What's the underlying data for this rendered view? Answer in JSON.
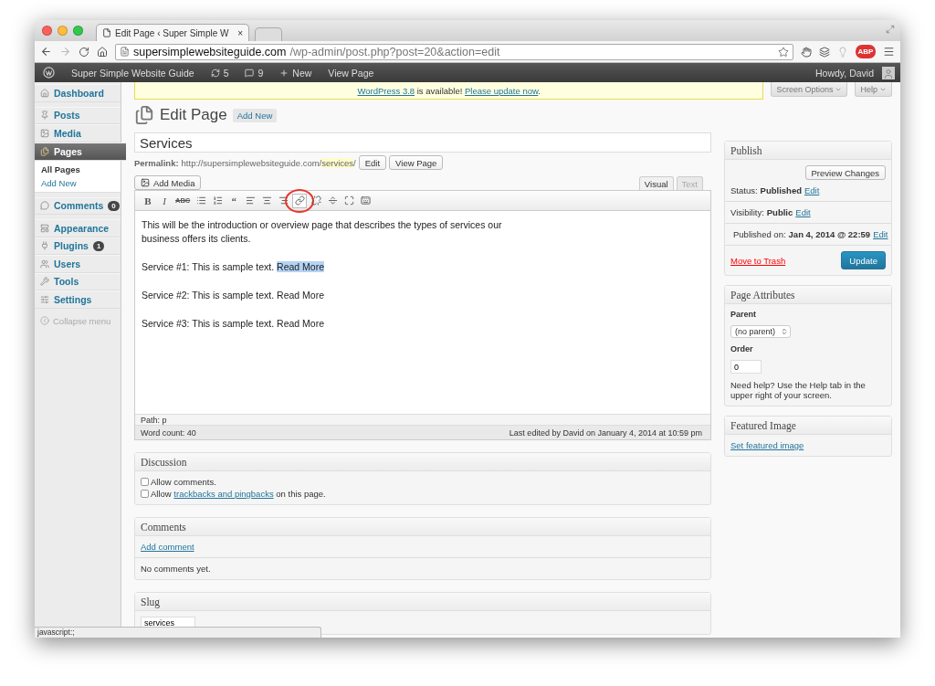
{
  "browser": {
    "tab_title": "Edit Page ‹ Super Simple W",
    "tab_close": "×",
    "url_host": "supersimplewebsiteguide.com",
    "url_path": "/wp-admin/post.php?post=20&action=edit",
    "extension_badge": "ABP"
  },
  "admin_bar": {
    "site": "Super Simple Website Guide",
    "updates": "5",
    "comments": "9",
    "new": "New",
    "view": "View Page",
    "greeting": "Howdy, David"
  },
  "sidebar": {
    "items": [
      {
        "label": "Dashboard",
        "selected": false
      },
      {
        "label": "Posts",
        "selected": false
      },
      {
        "label": "Media",
        "selected": false
      },
      {
        "label": "Pages",
        "selected": true,
        "children": [
          {
            "label": "All Pages",
            "selected": true
          },
          {
            "label": "Add New",
            "selected": false
          }
        ]
      },
      {
        "label": "Comments",
        "selected": false,
        "badge": "0"
      },
      {
        "label": "Appearance",
        "selected": false
      },
      {
        "label": "Plugins",
        "selected": false,
        "badge": "1"
      },
      {
        "label": "Users",
        "selected": false
      },
      {
        "label": "Tools",
        "selected": false
      },
      {
        "label": "Settings",
        "selected": false
      }
    ],
    "collapse": "Collapse menu"
  },
  "notice": {
    "parts": [
      {
        "text": "WordPress 3.8",
        "link": true
      },
      {
        "text": " is available! ",
        "link": false
      },
      {
        "text": "Please update now",
        "link": true
      },
      {
        "text": ".",
        "link": false
      }
    ]
  },
  "screen_tabs": [
    "Screen Options",
    "Help"
  ],
  "heading": {
    "title": "Edit Page",
    "add_new": "Add New"
  },
  "editor": {
    "title": "Services",
    "permalink_label": "Permalink:",
    "permalink_base": "http://supersimplewebsiteguide.com/",
    "permalink_slug": "services",
    "permalink_end": "/",
    "edit": "Edit",
    "view": "View Page",
    "add_media": "Add Media",
    "tabs": [
      {
        "label": "Visual",
        "selected": true
      },
      {
        "label": "Text",
        "selected": false
      }
    ],
    "toolbar": [
      {
        "kind": "bold",
        "label": "B",
        "circled": false
      },
      {
        "kind": "italic",
        "label": "I",
        "circled": false
      },
      {
        "kind": "strike",
        "label": "ABC",
        "circled": false
      },
      {
        "kind": "bullets",
        "circled": false
      },
      {
        "kind": "numbers",
        "circled": false
      },
      {
        "kind": "quote",
        "label": "“",
        "circled": false
      },
      {
        "kind": "align-left",
        "circled": false
      },
      {
        "kind": "align-center",
        "circled": false
      },
      {
        "kind": "align-right",
        "circled": false
      },
      {
        "kind": "link",
        "circled": true
      },
      {
        "kind": "unlink",
        "circled": false
      },
      {
        "kind": "more",
        "circled": false
      },
      {
        "kind": "fullscreen",
        "circled": false
      },
      {
        "kind": "kitchen-sink",
        "circled": false
      }
    ],
    "paragraphs": [
      {
        "lines": [
          "This will be the introduction or overview page that describes the types of services our",
          "business offers its clients."
        ]
      },
      {
        "lines": [
          "Service #1: This is sample text."
        ],
        "link": "Read More",
        "link_selected": true
      },
      {
        "lines": [
          "Service #2: This is sample text."
        ],
        "link": "Read More",
        "link_selected": false
      },
      {
        "lines": [
          "Service #3: This is sample text."
        ],
        "link": "Read More",
        "link_selected": false
      }
    ],
    "path": "Path: p",
    "word_count": "Word count: 40",
    "last_edited": "Last edited by David on January 4, 2014 at 10:59 pm"
  },
  "discussion": {
    "title": "Discussion",
    "options": [
      {
        "checked": false,
        "parts": [
          {
            "text": "Allow comments.",
            "link": false
          }
        ]
      },
      {
        "checked": false,
        "parts": [
          {
            "text": "Allow ",
            "link": false
          },
          {
            "text": "trackbacks and pingbacks",
            "link": true
          },
          {
            "text": " on this page.",
            "link": false
          }
        ]
      }
    ]
  },
  "comments": {
    "title": "Comments",
    "add": "Add comment",
    "empty": "No comments yet."
  },
  "slug": {
    "title": "Slug",
    "value": "services"
  },
  "publish": {
    "title": "Publish",
    "preview": "Preview Changes",
    "rows": [
      {
        "label": "Status:",
        "value": "Published",
        "edit": "Edit"
      },
      {
        "label": "Visibility:",
        "value": "Public",
        "edit": "Edit"
      },
      {
        "label": "Published on:",
        "value": "Jan 4, 2014 @ 22:59",
        "edit": "Edit"
      }
    ],
    "trash": "Move to Trash",
    "update": "Update"
  },
  "page_attributes": {
    "title": "Page Attributes",
    "parent_label": "Parent",
    "parent_value": "(no parent)",
    "order_label": "Order",
    "order_value": "0",
    "help": "Need help? Use the Help tab in the upper right of your screen."
  },
  "featured_image": {
    "title": "Featured Image",
    "link": "Set featured image"
  },
  "status_bar": "javascript:;"
}
